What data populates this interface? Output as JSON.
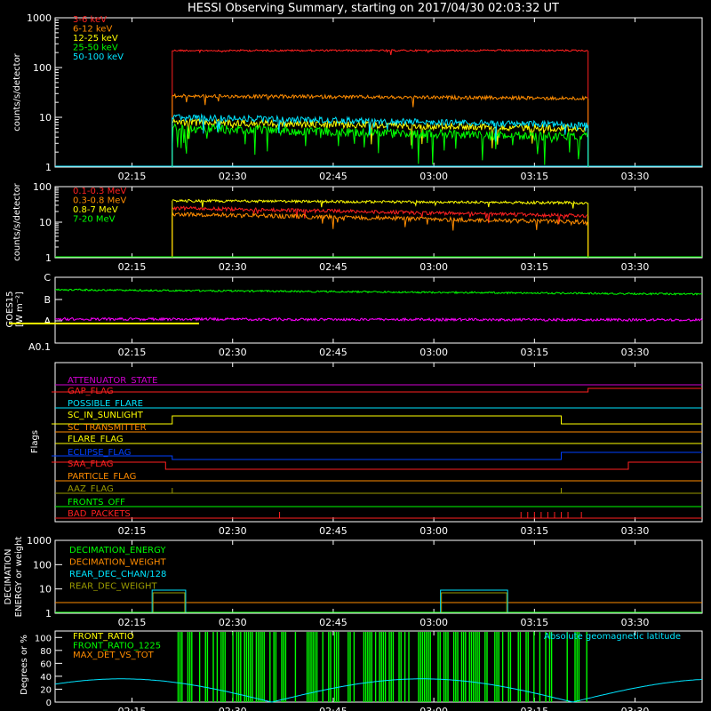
{
  "title": "HESSI Observing Summary, starting on 2017/04/30 02:03:32 UT",
  "time_ticks": [
    "02:15",
    "02:30",
    "02:45",
    "03:00",
    "03:15",
    "03:30"
  ],
  "chart_data": [
    {
      "type": "line",
      "ylabel": "counts/s/detector",
      "yscale": "log",
      "ylim": [
        1,
        1000
      ],
      "ytick_labels": [
        "1",
        "10",
        "100",
        "1000"
      ],
      "legend": "top-left",
      "series": [
        {
          "name": "3-6 keV",
          "color": "#ff2020",
          "x": [
            "02:21",
            "03:23"
          ],
          "y": [
            220,
            220
          ]
        },
        {
          "name": "6-12 keV",
          "color": "#ff8c00",
          "x": [
            "02:21",
            "03:23"
          ],
          "y": [
            27,
            24
          ]
        },
        {
          "name": "12-25 keV",
          "color": "#ffff00",
          "x": [
            "02:21",
            "03:23"
          ],
          "y": [
            8,
            6
          ]
        },
        {
          "name": "25-50 keV",
          "color": "#00ff00",
          "x": [
            "02:21",
            "03:23"
          ],
          "y": [
            6,
            4
          ]
        },
        {
          "name": "50-100 keV",
          "color": "#00e5ff",
          "x": [
            "02:21",
            "03:23"
          ],
          "y": [
            10,
            7
          ]
        }
      ]
    },
    {
      "type": "line",
      "ylabel": "counts/s/detector",
      "yscale": "log",
      "ylim": [
        1,
        100
      ],
      "ytick_labels": [
        "1",
        "10",
        "100"
      ],
      "legend": "top-left",
      "series": [
        {
          "name": "0.1-0.3 MeV",
          "color": "#ff2020",
          "x": [
            "02:21",
            "03:23"
          ],
          "y": [
            25,
            15
          ]
        },
        {
          "name": "0.3-0.8 MeV",
          "color": "#ff8c00",
          "x": [
            "02:21",
            "03:23"
          ],
          "y": [
            17,
            10
          ]
        },
        {
          "name": "0.8-7 MeV",
          "color": "#ffff00",
          "x": [
            "02:21",
            "03:23"
          ],
          "y": [
            40,
            35
          ]
        },
        {
          "name": "7-20 MeV",
          "color": "#00ff00",
          "x": [
            "02:03",
            "03:40"
          ],
          "y": [
            1,
            1
          ]
        }
      ]
    },
    {
      "type": "line",
      "ylabel": "GOES15",
      "ylabel2": "[W m⁻²]",
      "yscale": "log",
      "ytick_labels": [
        "A0.1",
        "A",
        "B",
        "C"
      ],
      "series": [
        {
          "color": "#00ff00",
          "x": [
            "02:03",
            "03:40"
          ],
          "y": [
            "B1.2",
            "B0.85"
          ]
        },
        {
          "color": "#ff00ff",
          "x": [
            "02:03",
            "03:40"
          ],
          "y": [
            "A1.0",
            "A1.0"
          ]
        },
        {
          "color": "#ffff00",
          "x": [
            "02:03",
            "02:25"
          ],
          "y": [
            "A0.8",
            "A0.8"
          ]
        }
      ]
    }
  ],
  "flags_panel": {
    "ylabel": "Flags",
    "flags": [
      {
        "name": "ATTENUATOR_STATE",
        "color": "#d000d0"
      },
      {
        "name": "GAP_FLAG",
        "color": "#ff2020"
      },
      {
        "name": "POSSIBLE_FLARE",
        "color": "#00e5ff"
      },
      {
        "name": "SC_IN_SUNLIGHT",
        "color": "#ffff00"
      },
      {
        "name": "SC_TRANSMITTER",
        "color": "#ff8c00"
      },
      {
        "name": "FLARE_FLAG",
        "color": "#ffff00"
      },
      {
        "name": "ECLIPSE_FLAG",
        "color": "#0040ff"
      },
      {
        "name": "SAA_FLAG",
        "color": "#ff2020"
      },
      {
        "name": "PARTICLE_FLAG",
        "color": "#ff8c00"
      },
      {
        "name": "AAZ_FLAG",
        "color": "#9a9a00"
      },
      {
        "name": "FRONTS_OFF",
        "color": "#00ff00"
      },
      {
        "name": "BAD_PACKETS",
        "color": "#ff2020"
      }
    ]
  },
  "decimation_panel": {
    "ylabel1": "DECIMATION",
    "ylabel2": "ENERGY or weight",
    "ytick_labels": [
      "1",
      "10",
      "100",
      "1000"
    ],
    "legend": [
      {
        "name": "DECIMATION_ENERGY",
        "color": "#00ff00"
      },
      {
        "name": "DECIMATION_WEIGHT",
        "color": "#ff8c00"
      },
      {
        "name": "REAR_DEC_CHAN/128",
        "color": "#00e5ff"
      },
      {
        "name": "REAR_DEC_WEIGHT",
        "color": "#9a9a00"
      }
    ]
  },
  "ratio_panel": {
    "ylabel": "Degrees or %",
    "ytick_labels": [
      "0",
      "20",
      "40",
      "60",
      "80",
      "100"
    ],
    "legend": [
      {
        "name": "FRONT_RATIO",
        "color": "#ffff00"
      },
      {
        "name": "FRONT_RATIO_1225",
        "color": "#00ff00"
      },
      {
        "name": "MAX_DET_VS_TOT",
        "color": "#ff8c00"
      }
    ],
    "right_label": "Absolute geomagnetic latitude",
    "right_label_color": "#00e5ff"
  }
}
